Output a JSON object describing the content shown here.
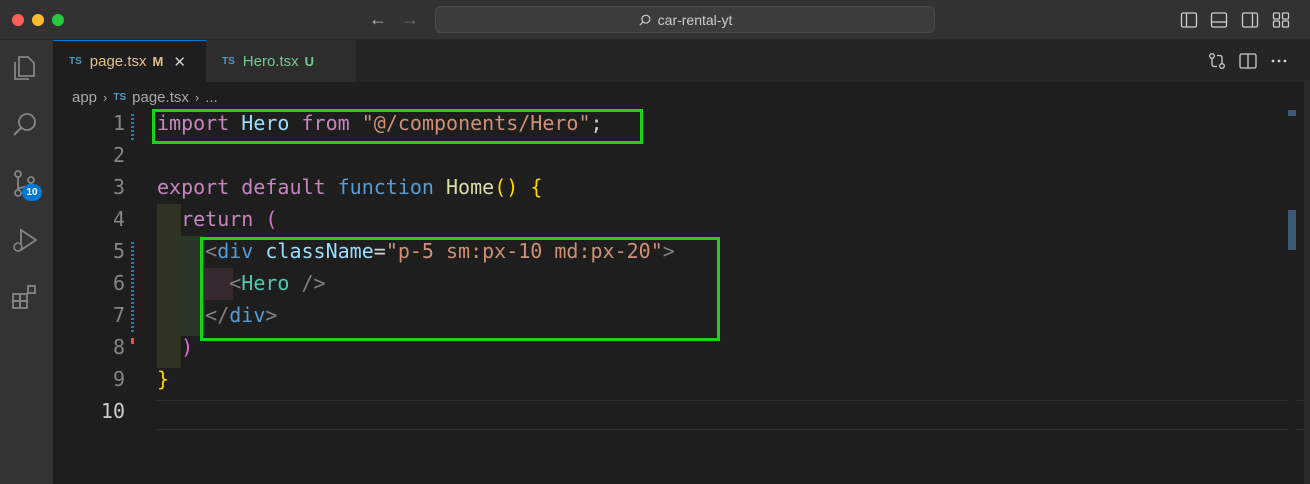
{
  "window": {
    "command_center": "car-rental-yt"
  },
  "tabs": [
    {
      "badge": "TS",
      "label": "page.tsx",
      "flag": "M",
      "close": "✕"
    },
    {
      "badge": "TS",
      "label": "Hero.tsx",
      "flag": "U"
    }
  ],
  "breadcrumb": {
    "folder": "app",
    "badge": "TS",
    "file": "page.tsx",
    "ellipsis": "..."
  },
  "activity": {
    "source_control_badge": "10"
  },
  "editor": {
    "line_numbers": [
      "1",
      "2",
      "3",
      "4",
      "5",
      "6",
      "7",
      "8",
      "9",
      "10"
    ],
    "current_line": "10",
    "lines": [
      [
        {
          "t": "import",
          "c": "kw"
        },
        {
          "t": " ",
          "c": "plain"
        },
        {
          "t": "Hero",
          "c": "var"
        },
        {
          "t": " ",
          "c": "plain"
        },
        {
          "t": "from",
          "c": "kw"
        },
        {
          "t": " ",
          "c": "plain"
        },
        {
          "t": "\"@/components/Hero\"",
          "c": "str"
        },
        {
          "t": ";",
          "c": "plain"
        }
      ],
      [],
      [
        {
          "t": "export",
          "c": "kw"
        },
        {
          "t": " ",
          "c": "plain"
        },
        {
          "t": "default",
          "c": "kw"
        },
        {
          "t": " ",
          "c": "plain"
        },
        {
          "t": "function",
          "c": "kw-blue"
        },
        {
          "t": " ",
          "c": "plain"
        },
        {
          "t": "Home",
          "c": "fn"
        },
        {
          "t": "()",
          "c": "brace-y"
        },
        {
          "t": " ",
          "c": "plain"
        },
        {
          "t": "{",
          "c": "brace-y"
        }
      ],
      [
        {
          "t": "  ",
          "c": "plain"
        },
        {
          "t": "return",
          "c": "kw"
        },
        {
          "t": " ",
          "c": "plain"
        },
        {
          "t": "(",
          "c": "paren-p"
        }
      ],
      [
        {
          "t": "    ",
          "c": "plain"
        },
        {
          "t": "<",
          "c": "punc"
        },
        {
          "t": "div",
          "c": "tag"
        },
        {
          "t": " ",
          "c": "plain"
        },
        {
          "t": "className",
          "c": "attr"
        },
        {
          "t": "=",
          "c": "plain"
        },
        {
          "t": "\"p-5 sm:px-10 md:px-20\"",
          "c": "str"
        },
        {
          "t": ">",
          "c": "punc"
        }
      ],
      [
        {
          "t": "      ",
          "c": "plain"
        },
        {
          "t": "<",
          "c": "punc"
        },
        {
          "t": "Hero",
          "c": "comp"
        },
        {
          "t": " ",
          "c": "plain"
        },
        {
          "t": "/>",
          "c": "punc"
        }
      ],
      [
        {
          "t": "    ",
          "c": "plain"
        },
        {
          "t": "</",
          "c": "punc"
        },
        {
          "t": "div",
          "c": "tag"
        },
        {
          "t": ">",
          "c": "punc"
        }
      ],
      [
        {
          "t": "  ",
          "c": "plain"
        },
        {
          "t": ")",
          "c": "paren-p"
        }
      ],
      [
        {
          "t": "}",
          "c": "brace-y"
        }
      ],
      []
    ]
  },
  "colors": {
    "highlight_box": "#18d318",
    "accent": "#0078d4"
  }
}
